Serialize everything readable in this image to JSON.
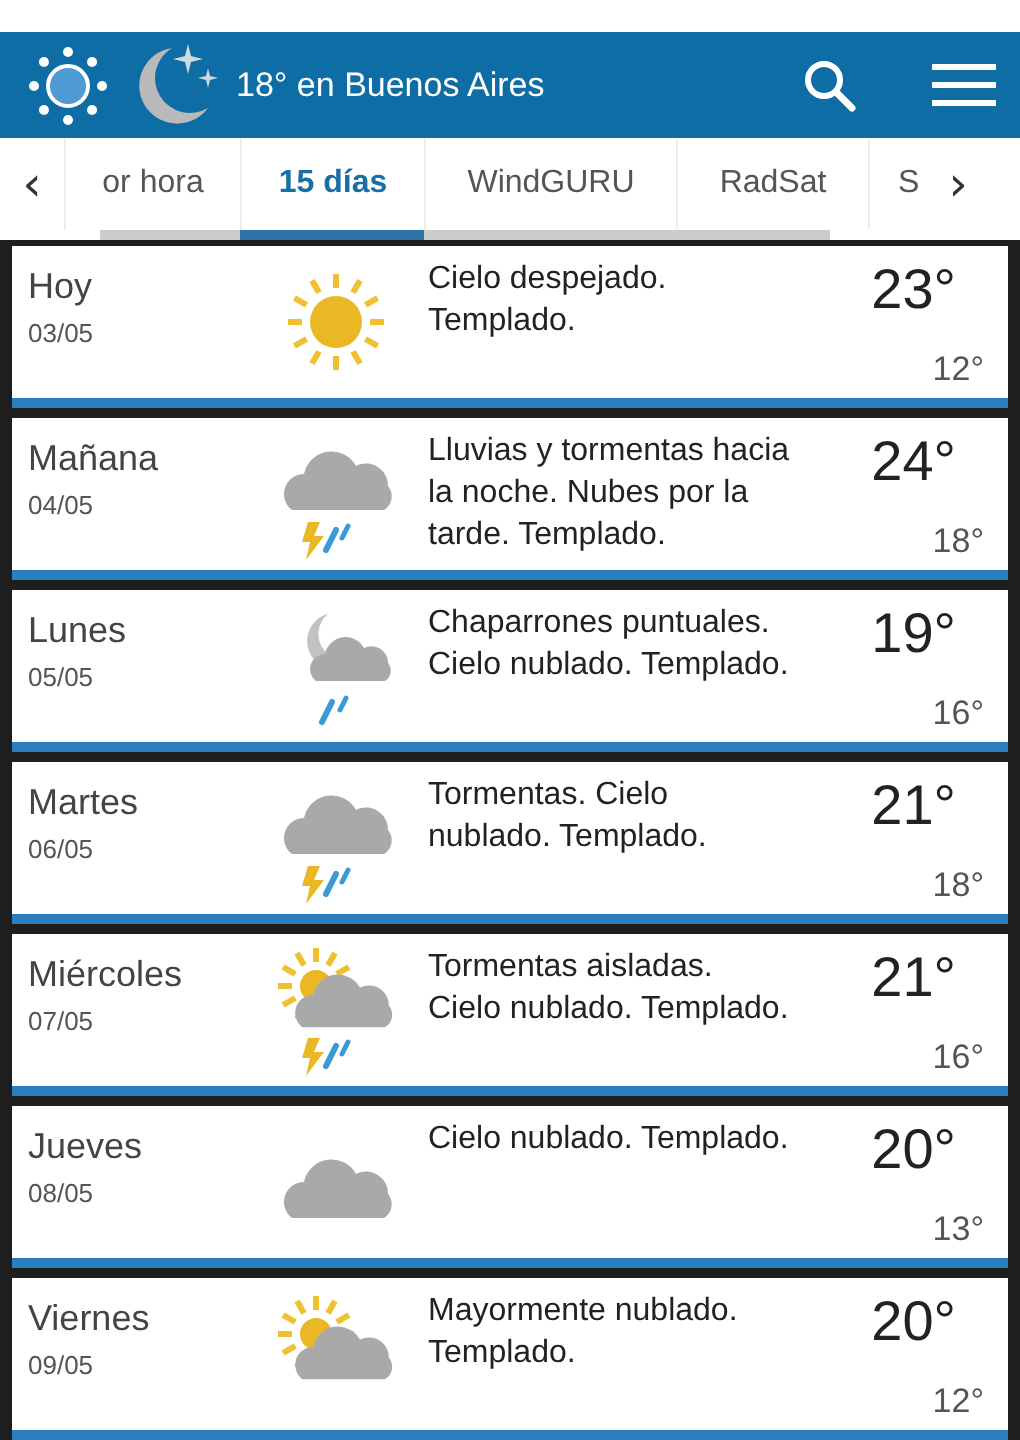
{
  "header": {
    "title": "18° en Buenos Aires"
  },
  "tabs": {
    "prev": "‹",
    "next": "›",
    "items": [
      {
        "label": "or hora",
        "selected": false
      },
      {
        "label": "15 días",
        "selected": true
      },
      {
        "label": "WindGURU",
        "selected": false
      },
      {
        "label": "RadSat",
        "selected": false
      },
      {
        "label": "S",
        "selected": false
      }
    ]
  },
  "days": [
    {
      "day": "Hoy",
      "date": "03/05",
      "kind": "sun",
      "summary": "Cielo despejado. Templado.",
      "high": "23°",
      "low": "12°"
    },
    {
      "day": "Mañana",
      "date": "04/05",
      "kind": "storm",
      "summary": "Lluvias y tormentas hacia la noche. Nubes por la tarde. Templado.",
      "high": "24°",
      "low": "18°"
    },
    {
      "day": "Lunes",
      "date": "05/05",
      "kind": "moon-rain",
      "summary": "Chaparrones puntuales. Cielo nublado. Templado.",
      "high": "19°",
      "low": "16°"
    },
    {
      "day": "Martes",
      "date": "06/05",
      "kind": "storm",
      "summary": "Tormentas. Cielo nublado. Templado.",
      "high": "21°",
      "low": "18°"
    },
    {
      "day": "Miércoles",
      "date": "07/05",
      "kind": "sun-storm",
      "summary": "Tormentas aisladas. Cielo nublado. Templado.",
      "high": "21°",
      "low": "16°"
    },
    {
      "day": "Jueves",
      "date": "08/05",
      "kind": "cloud",
      "summary": "Cielo nublado. Templado.",
      "high": "20°",
      "low": "13°"
    },
    {
      "day": "Viernes",
      "date": "09/05",
      "kind": "sun-cloud",
      "summary": "Mayormente nublado. Templado.",
      "high": "20°",
      "low": "12°"
    }
  ]
}
